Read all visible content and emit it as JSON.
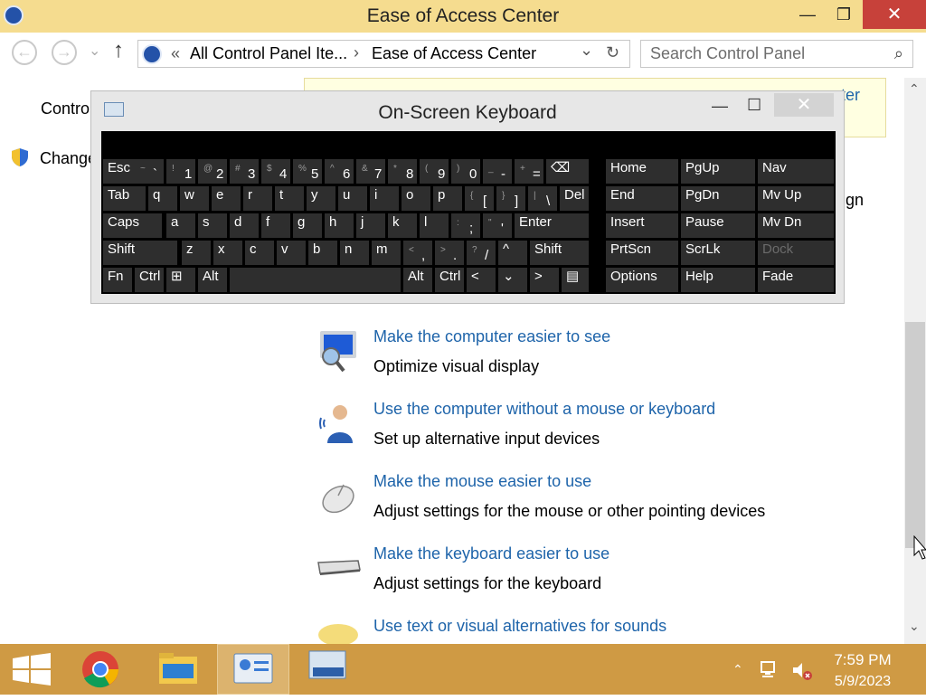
{
  "window": {
    "title": "Ease of Access Center",
    "minimize": "—",
    "maximize": "❐",
    "close": "✕"
  },
  "nav": {
    "back_icon": "←",
    "forward_icon": "→",
    "recent_icon": "⌄",
    "up_icon": "↑",
    "breadcrumb_sep": "«",
    "breadcrumb": [
      "All Control Panel Ite...",
      "Ease of Access Center"
    ],
    "crumb_arrow": "›",
    "dropdown_icon": "⌄",
    "refresh_icon": "↻",
    "search_placeholder": "Search Control Panel",
    "search_icon": "⌕"
  },
  "left_pane": {
    "items": [
      "Contro",
      "Change"
    ]
  },
  "infobar": {
    "partial_text": "ter"
  },
  "right_partial": "gn",
  "osk": {
    "title": "On-Screen Keyboard",
    "minimize": "—",
    "maximize": "☐",
    "close": "✕"
  },
  "keys": {
    "row1": [
      {
        "label": "Esc"
      },
      {
        "sub": "~",
        "main": "`"
      },
      {
        "sub": "!",
        "main": "1"
      },
      {
        "sub": "@",
        "main": "2"
      },
      {
        "sub": "#",
        "main": "3"
      },
      {
        "sub": "$",
        "main": "4"
      },
      {
        "sub": "%",
        "main": "5"
      },
      {
        "sub": "^",
        "main": "6"
      },
      {
        "sub": "&",
        "main": "7"
      },
      {
        "sub": "*",
        "main": "8"
      },
      {
        "sub": "(",
        "main": "9"
      },
      {
        "sub": ")",
        "main": "0"
      },
      {
        "sub": "_",
        "main": "-"
      },
      {
        "sub": "+",
        "main": "="
      },
      {
        "label": "⌫"
      }
    ],
    "row2": [
      {
        "label": "Tab"
      },
      {
        "label": "q"
      },
      {
        "label": "w"
      },
      {
        "label": "e"
      },
      {
        "label": "r"
      },
      {
        "label": "t"
      },
      {
        "label": "y"
      },
      {
        "label": "u"
      },
      {
        "label": "i"
      },
      {
        "label": "o"
      },
      {
        "label": "p"
      },
      {
        "sub": "{",
        "main": "["
      },
      {
        "sub": "}",
        "main": "]"
      },
      {
        "sub": "|",
        "main": "\\"
      },
      {
        "label": "Del"
      }
    ],
    "row3": [
      {
        "label": "Caps"
      },
      {
        "label": "a"
      },
      {
        "label": "s"
      },
      {
        "label": "d"
      },
      {
        "label": "f"
      },
      {
        "label": "g"
      },
      {
        "label": "h"
      },
      {
        "label": "j"
      },
      {
        "label": "k"
      },
      {
        "label": "l"
      },
      {
        "sub": ":",
        "main": ";"
      },
      {
        "sub": "\"",
        "main": "'"
      },
      {
        "label": "Enter"
      }
    ],
    "row4": [
      {
        "label": "Shift"
      },
      {
        "label": "z"
      },
      {
        "label": "x"
      },
      {
        "label": "c"
      },
      {
        "label": "v"
      },
      {
        "label": "b"
      },
      {
        "label": "n"
      },
      {
        "label": "m"
      },
      {
        "sub": "<",
        "main": ","
      },
      {
        "sub": ">",
        "main": "."
      },
      {
        "sub": "?",
        "main": "/"
      },
      {
        "label": "^"
      },
      {
        "label": "Shift"
      }
    ],
    "row5": [
      {
        "label": "Fn"
      },
      {
        "label": "Ctrl"
      },
      {
        "label": "⊞"
      },
      {
        "label": "Alt"
      },
      {
        "label": ""
      },
      {
        "label": "Alt"
      },
      {
        "label": "Ctrl"
      },
      {
        "label": "<"
      },
      {
        "label": "⌄"
      },
      {
        "label": ">"
      },
      {
        "label": "▤"
      }
    ],
    "nav_block": [
      [
        "Home",
        "PgUp",
        "Nav"
      ],
      [
        "End",
        "PgDn",
        "Mv Up"
      ],
      [
        "Insert",
        "Pause",
        "Mv Dn"
      ],
      [
        "PrtScn",
        "ScrLk",
        "Dock"
      ],
      [
        "Options",
        "Help",
        "Fade"
      ]
    ]
  },
  "items": [
    {
      "link": "Make the computer easier to see",
      "desc": "Optimize visual display",
      "icon": "monitor-magnifier-icon"
    },
    {
      "link": "Use the computer without a mouse or keyboard",
      "desc": "Set up alternative input devices",
      "icon": "speech-person-icon"
    },
    {
      "link": "Make the mouse easier to use",
      "desc": "Adjust settings for the mouse or other pointing devices",
      "icon": "mouse-icon"
    },
    {
      "link": "Make the keyboard easier to use",
      "desc": "Adjust settings for the keyboard",
      "icon": "keyboard-icon"
    },
    {
      "link": "Use text or visual alternatives for sounds",
      "desc": "",
      "icon": "speech-bubble-icon"
    }
  ],
  "scroll": {
    "up": "⌃",
    "down": "⌄",
    "thumb_position": 0.55
  },
  "taskbar": {
    "time": "7:59 PM",
    "date": "5/9/2023",
    "tray_up": "⌃"
  },
  "colors": {
    "titlebar": "#f5dc8f",
    "taskbar": "#cf9a44",
    "link": "#1e64aa",
    "close": "#c7413a",
    "key": "#2e2e2e"
  }
}
